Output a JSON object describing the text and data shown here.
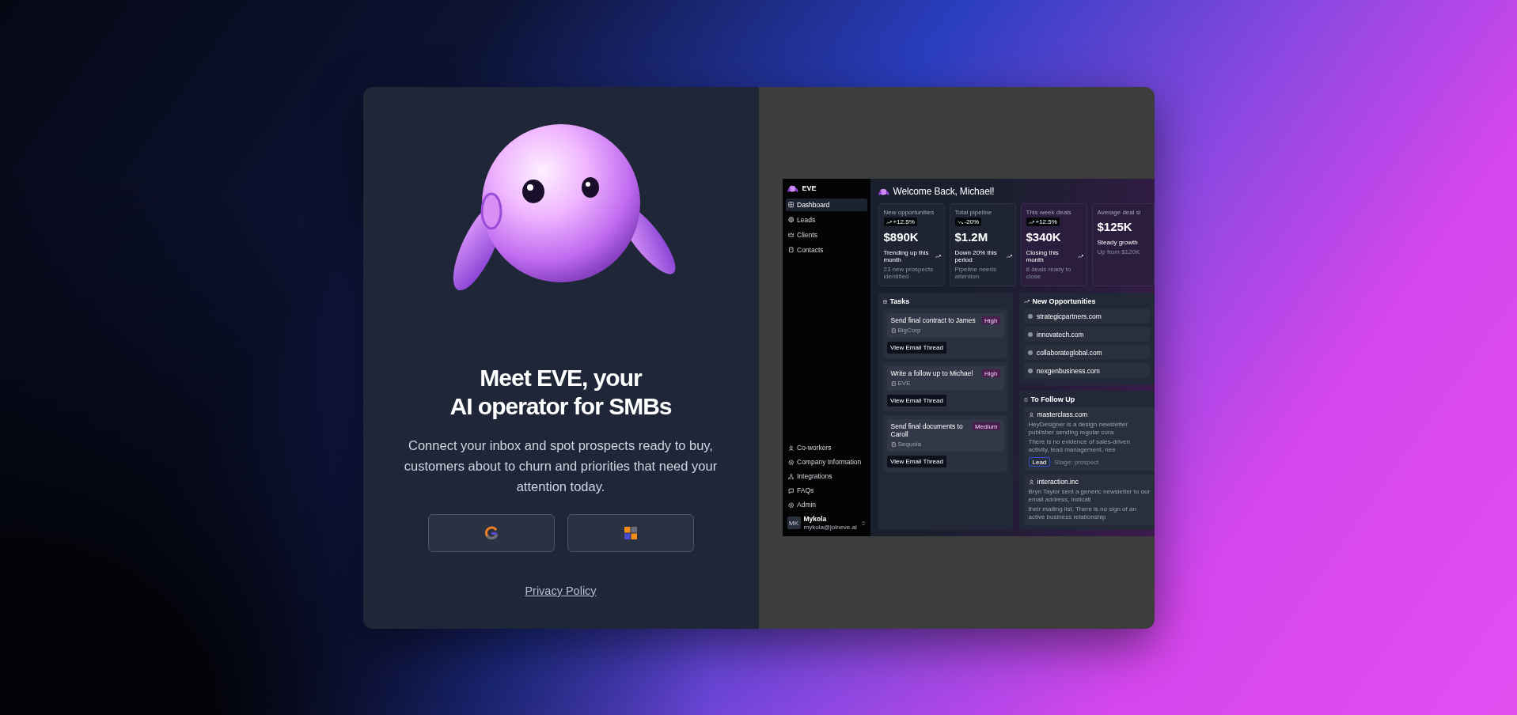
{
  "login": {
    "title_lines": [
      "Meet EVE, your",
      "AI operator for SMBs"
    ],
    "description": "Connect your inbox and spot prospects ready to buy, customers about to churn and priorities that need your attention today.",
    "sign_in_buttons": [
      {
        "kind": "google"
      },
      {
        "kind": "microsoft"
      }
    ],
    "privacy_link": "Privacy Policy"
  },
  "preview": {
    "brand": "EVE",
    "sidebar": {
      "items": [
        {
          "label": "Dashboard",
          "selected": true
        },
        {
          "label": "Leads",
          "selected": false
        },
        {
          "label": "Clients",
          "selected": false
        },
        {
          "label": "Contacts",
          "selected": false
        }
      ],
      "footer_items": [
        {
          "label": "Co-workers",
          "selected": false
        },
        {
          "label": "Company Information",
          "selected": false
        },
        {
          "label": "Integrations",
          "selected": false
        },
        {
          "label": "FAQs",
          "selected": false
        },
        {
          "label": "Admin",
          "selected": false
        }
      ],
      "user": {
        "initials": "MK",
        "name": "Mykola",
        "email": "mykola@joineve.ai"
      }
    },
    "greeting": "Welcome Back, Michael!",
    "stats": [
      {
        "label": "New opportunities",
        "badge": "+12.5%",
        "rising": true,
        "value": "$890K",
        "trend": "Trending up this month",
        "note": "23 new prospects identified"
      },
      {
        "label": "Total pipeline",
        "badge": "-20%",
        "rising": false,
        "value": "$1.2M",
        "trend": "Down 20% this period",
        "note": "Pipeline needs attention"
      },
      {
        "label": "This week deals",
        "badge": "+12.5%",
        "rising": true,
        "value": "$340K",
        "trend": "Closing this month",
        "note": "8 deals ready to close"
      },
      {
        "label": "Average deal si",
        "value": "$125K",
        "trend": "Steady growth",
        "note": "Up from $120K"
      }
    ],
    "tasks": {
      "title": "Tasks",
      "items": [
        {
          "title": "Send final contract to James",
          "company": "BigCorp",
          "priority": "High",
          "action": "View Email Thread"
        },
        {
          "title": "Write a follow up to Michael",
          "company": "EVE",
          "priority": "High",
          "action": "View Email Thread"
        },
        {
          "title": "Send final documents to Caroll",
          "company": "Sequoia",
          "priority": "Medium",
          "action": "View Email Thread"
        }
      ]
    },
    "opportunities": {
      "title": "New Opportunities",
      "items": [
        "strategicpartners.com",
        "innovatech.com",
        "collaborateglobal.com",
        "nexgenbusiness.com"
      ]
    },
    "follow_up": {
      "title": "To Follow Up",
      "items": [
        {
          "name": "masterclass.com",
          "description_lines": [
            "HeyDesigner is a design newsletter publisher sending regular cura",
            "There is no evidence of sales-driven activity, lead management, nee"
          ],
          "tag": "Lead",
          "stage": "Stage: prospect"
        },
        {
          "name": "interaction.inc",
          "description_lines": [
            "Bryn Taylor sent a generic newsletter to our email address, indicati",
            "their mailing list. There is no sign of an active business relationship"
          ]
        }
      ]
    }
  }
}
